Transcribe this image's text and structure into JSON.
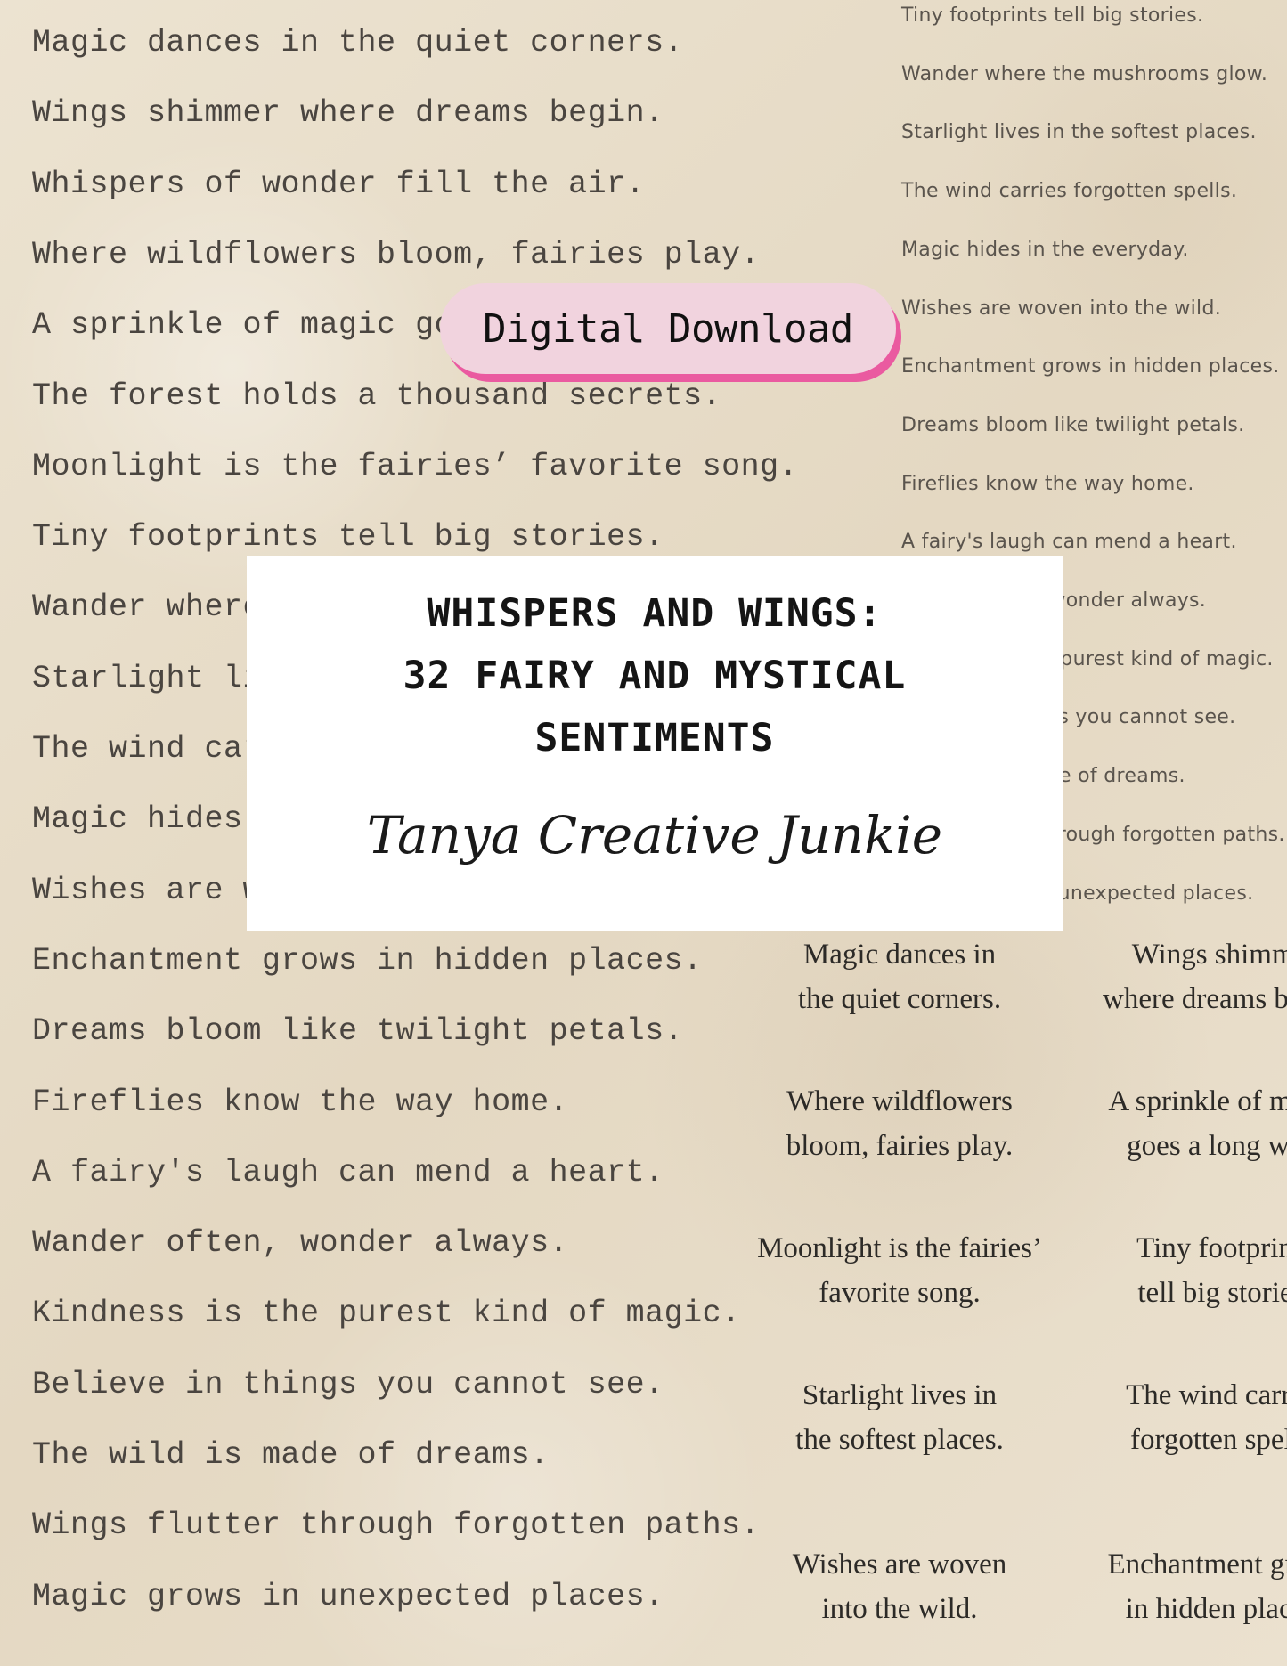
{
  "left_sentiments": [
    "Magic dances in the quiet corners.",
    "Wings shimmer where dreams begin.",
    "Whispers of wonder fill the air.",
    "Where wildflowers bloom, fairies play.",
    "A sprinkle of magic goes a long way.",
    "The forest holds a thousand secrets.",
    "Moonlight is the fairies’ favorite song.",
    "Tiny footprints tell big stories.",
    "Wander where the mushrooms glow.",
    "Starlight lives in the softest places.",
    "The wind carries forgotten spells.",
    "Magic hides in the everyday.",
    "Wishes are woven into the wild.",
    "Enchantment grows in hidden places.",
    "Dreams bloom like twilight petals.",
    "Fireflies know the way home.",
    "A fairy's laugh can mend a heart.",
    "Wander often, wonder always.",
    "Kindness is the purest kind of magic.",
    "Believe in things you cannot see.",
    "The wild is made of dreams.",
    "Wings flutter through forgotten paths.",
    "Magic grows in unexpected places."
  ],
  "right_sentiments": [
    "Tiny footprints tell big stories.",
    "Wander where the mushrooms glow.",
    "Starlight lives in the softest places.",
    "The wind carries forgotten spells.",
    "Magic hides in the everyday.",
    "Wishes are woven into the wild.",
    "Enchantment grows in hidden places.",
    "Dreams bloom like twilight petals.",
    "Fireflies know the way home.",
    "A fairy's laugh can mend a heart.",
    "Wander often, wonder always.",
    "Kindness is the purest kind of magic.",
    "Believe in things you cannot see.",
    "The wild is made of dreams.",
    "Wings flutter through forgotten paths.",
    "Magic grows in unexpected places."
  ],
  "tags": [
    {
      "line1": "Magic dances in",
      "line2": "the quiet corners."
    },
    {
      "line1": "Wings shimmer",
      "line2": "where dreams begin."
    },
    {
      "line1": "Where wildflowers",
      "line2": "bloom, fairies play."
    },
    {
      "line1": "A sprinkle of magic",
      "line2": "goes a long way."
    },
    {
      "line1": "Moonlight is the fairies’",
      "line2": "favorite song."
    },
    {
      "line1": "Tiny footprints",
      "line2": "tell big stories."
    },
    {
      "line1": "Starlight lives in",
      "line2": "the softest places."
    },
    {
      "line1": "The wind carries",
      "line2": "forgotten spells."
    },
    {
      "line1": "Wishes are woven",
      "line2": "into the wild."
    },
    {
      "line1": "Enchantment grows",
      "line2": "in hidden places."
    }
  ],
  "badge": {
    "label": "Digital Download"
  },
  "title_card": {
    "line1": "WHISPERS AND WINGS:",
    "line2": "32 FAIRY AND MYSTICAL",
    "line3": "SENTIMENTS",
    "signature": "Tanya Creative Junkie"
  },
  "colors": {
    "badge_bg": "#f1d3de",
    "badge_shadow": "#ea5aa0",
    "paper": "#e9dfcc"
  }
}
